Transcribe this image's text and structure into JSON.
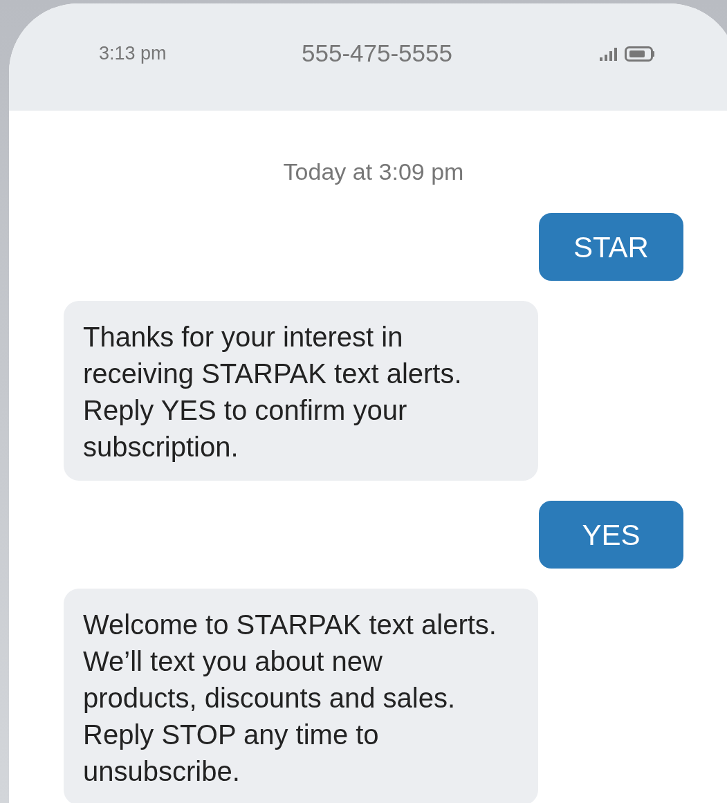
{
  "status_bar": {
    "time": "3:13 pm",
    "contact": "555-475-5555"
  },
  "timestamp": "Today at 3:09 pm",
  "messages": [
    {
      "kind": "sent",
      "text": "STAR"
    },
    {
      "kind": "received",
      "text": "Thanks for your interest in receiving STARPAK text alerts. Reply YES to confirm your subscription."
    },
    {
      "kind": "sent",
      "text": "YES"
    },
    {
      "kind": "received",
      "text": "Welcome to STARPAK text alerts. We’ll text you about new products, discounts and sales. Reply STOP any time to unsubscribe."
    }
  ]
}
